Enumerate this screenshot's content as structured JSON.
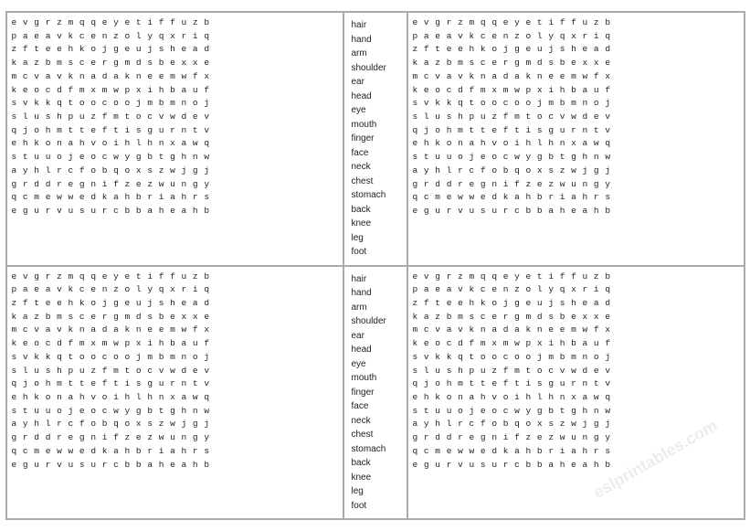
{
  "grid_rows_top": [
    "e v g r z m q q e y e t i f f u z b",
    "p a e a v k c e n z o l y q x r i q",
    "z f t e e h k o j g e u j s h e a d",
    "k a z b m s c e r g m d s b e x x e",
    "m c v a v k n a d a k n e e m w f x",
    "k e o c d f m x m w p x i h b a u f",
    "s v k k q t o o c o o j m b m n o j",
    "s l u s h p u z f m t o c v w d e v",
    "q j o h m t t e f t i s g u r n t v",
    "e h k o n a h v o i h l h n x a w q",
    "s t u u o j e o c w y g b t g h n w",
    "a y h l r c f o b q o x s z w j g j",
    "g r d d r e g n i f z e z w u n g y",
    "q c m e w w e d k a h b r i a h r s",
    "e g u r v u s u r c b b a h e a h b"
  ],
  "grid_rows_bottom": [
    "e v g r z m q q e y e t i f f u z b",
    "p a e a v k c e n z o l y q x r i q",
    "z f t e e h k o j g e u j s h e a d",
    "k a z b m s c e r g m d s b e x x e",
    "m c v a v k n a d a k n e e m w f x",
    "k e o c d f m x m w p x i h b a u f",
    "s v k k q t o o c o o j m b m n o j",
    "s l u s h p u z f m t o c v w d e v",
    "q j o h m t t e f t i s g u r n t v",
    "e h k o n a h v o i h l h n x a w q",
    "s t u u o j e o c w y g b t g h n w",
    "a y h l r c f o b q o x s z w j g j",
    "g r d d r e g n i f z e z w u n g y",
    "q c m e w w e d k a h b r i a h r s",
    "e g u r v u s u r c b b a h e a h b"
  ],
  "grid_rows_top_right": [
    "e v g r z m q q e y e t i f f u z b",
    "p a e a v k c e n z o l y q x r i q",
    "z f t e e h k o j g e u j s h e a d",
    "k a z b m s c e r g m d s b e x x e",
    "m c v a v k n a d a k n e e m w f x",
    "k e o c d f m x m w p x i h b a u f",
    "s v k k q t o o c o o j m b m n o j",
    "s l u s h p u z f m t o c v w d e v",
    "q j o h m t t e f t i s g u r n t v",
    "e h k o n a h v o i h l h n x a w q",
    "s t u u o j e o c w y g b t g h n w",
    "a y h l r c f o b q o x s z w j g j",
    "g r d d r e g n i f z e z w u n g y",
    "q c m e w w e d k a h b r i a h r s",
    "e g u r v u s u r c b b a h e a h b"
  ],
  "grid_rows_bottom_right": [
    "e v g r z m q q e y e t i f f u z b",
    "p a e a v k c e n z o l y q x r i q",
    "z f t e e h k o j g e u j s h e a d",
    "k a z b m s c e r g m d s b e x x e",
    "m c v a v k n a d a k n e e m w f x",
    "k e o c d f m x m w p x i h b a u f",
    "s v k k q t o o c o o j m b m n o j",
    "s l u s h p u z f m t o c v w d e v",
    "q j o h m t t e f t i s g u r n t v",
    "e h k o n a h v o i h l h n x a w q",
    "s t u u o j e o c w y g b t g h n w",
    "a y h l r c f o b q o x s z w j g j",
    "g r d d r e g n i f z e z w u n g y",
    "q c m e w w e d k a h b r i a h r s",
    "e g u r v u s u r c b b a h e a h b"
  ],
  "word_list": [
    "hair",
    "hand",
    "arm",
    "shoulder",
    "ear",
    "head",
    "eye",
    "mouth",
    "finger",
    "face",
    "neck",
    "chest",
    "stomach",
    "back",
    "knee",
    "leg",
    "foot"
  ],
  "watermark": "eslprintables.com"
}
